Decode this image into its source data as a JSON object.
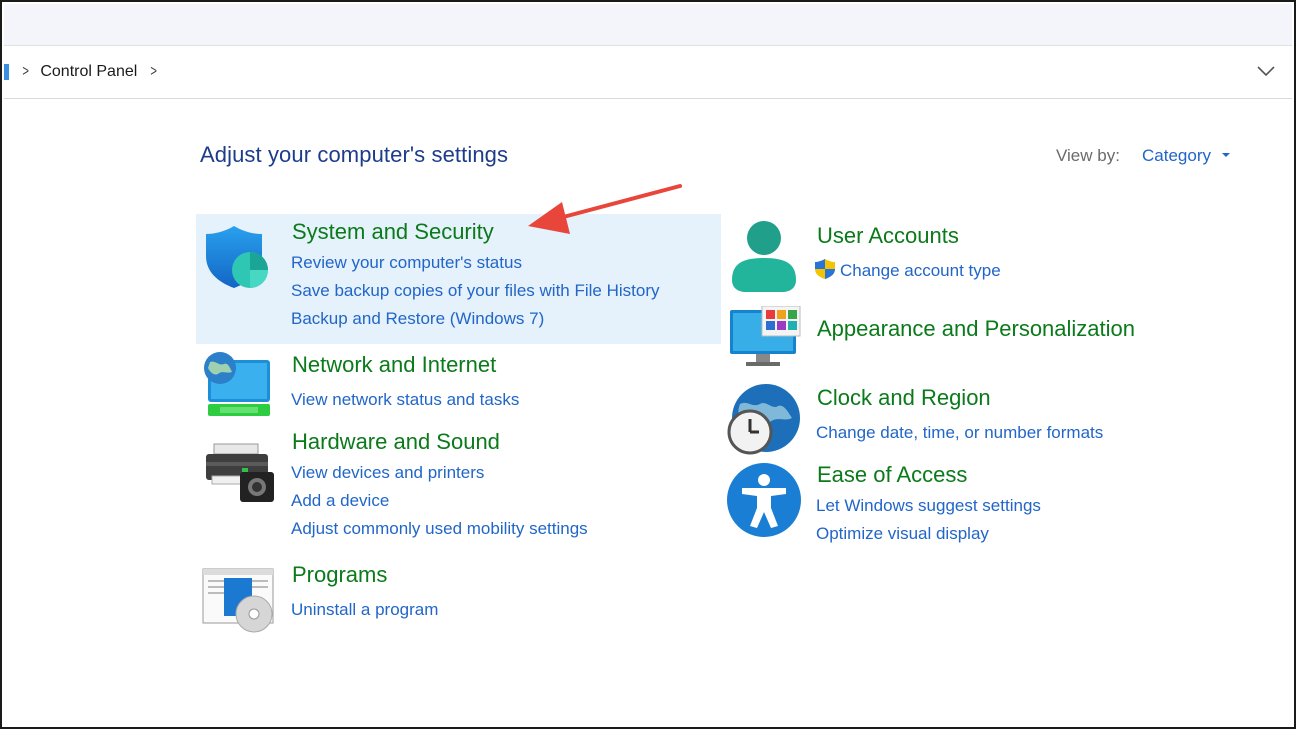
{
  "breadcrumb": {
    "items": [
      "Control Panel"
    ]
  },
  "main": {
    "heading": "Adjust your computer's settings",
    "view_by": {
      "label": "View by:",
      "value": "Category"
    }
  },
  "categories": {
    "system_security": {
      "title": "System and Security",
      "links": [
        "Review your computer's status",
        "Save backup copies of your files with File History",
        "Backup and Restore (Windows 7)"
      ]
    },
    "network": {
      "title": "Network and Internet",
      "links": [
        "View network status and tasks"
      ]
    },
    "hardware": {
      "title": "Hardware and Sound",
      "links": [
        "View devices and printers",
        "Add a device",
        "Adjust commonly used mobility settings"
      ]
    },
    "programs": {
      "title": "Programs",
      "links": [
        "Uninstall a program"
      ]
    },
    "user_accounts": {
      "title": "User Accounts",
      "links": [
        "Change account type"
      ]
    },
    "appearance": {
      "title": "Appearance and Personalization",
      "links": []
    },
    "clock": {
      "title": "Clock and Region",
      "links": [
        "Change date, time, or number formats"
      ]
    },
    "ease": {
      "title": "Ease of Access",
      "links": [
        "Let Windows suggest settings",
        "Optimize visual display"
      ]
    }
  },
  "colors": {
    "title_green": "#0b7a1a",
    "link_blue": "#2166c8",
    "heading_blue": "#1e3c8c",
    "highlight": "#e5f1fb",
    "annotation_red": "#e8463a"
  }
}
